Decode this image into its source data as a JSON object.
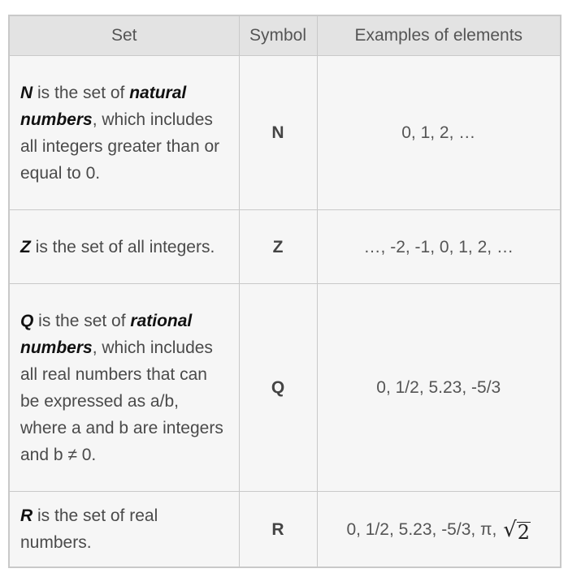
{
  "headers": [
    "Set",
    "Symbol",
    "Examples of elements"
  ],
  "rows": [
    {
      "set": {
        "name": "N",
        "t1": " is the set of ",
        "emph": "natural numbers",
        "t2": ", which includes all integers greater than or equal to 0."
      },
      "symbol": "N",
      "examples": "0, 1, 2, …"
    },
    {
      "set": {
        "name": "Z",
        "t1": " is the set of all integers.",
        "emph": "",
        "t2": ""
      },
      "symbol": "Z",
      "examples": "…, -2, -1, 0, 1, 2, …"
    },
    {
      "set": {
        "name": "Q",
        "t1": " is the set of ",
        "emph": "rational numbers",
        "t2": ", which includes all real numbers that can be expressed as a/b, where a and b are integers and b ≠ 0."
      },
      "symbol": "Q",
      "examples": "0, 1/2, 5.23, -5/3"
    },
    {
      "set": {
        "name": "R",
        "t1": " is the set of real numbers.",
        "emph": "",
        "t2": ""
      },
      "symbol": "R",
      "examples": "0, 1/2, 5.23, -5/3, π, ",
      "examples_sqrt": {
        "radical": "√",
        "radicand": "2"
      }
    }
  ]
}
